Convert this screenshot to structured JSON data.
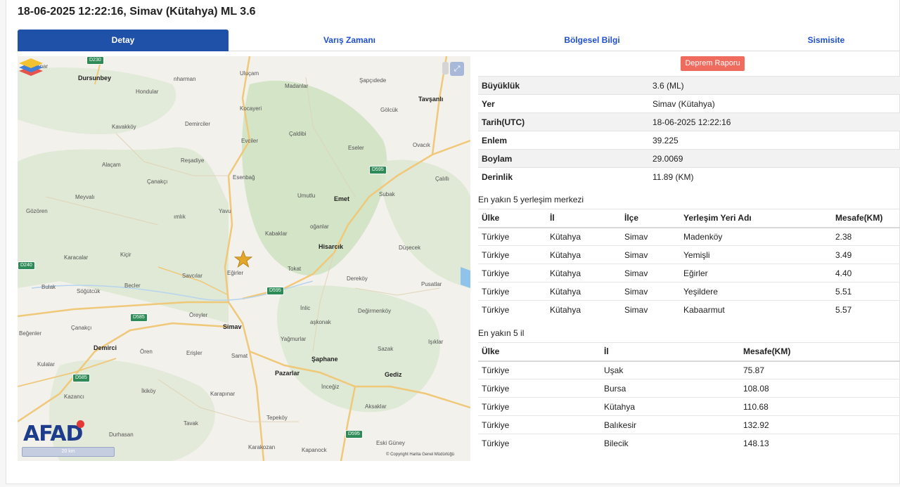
{
  "title": "18-06-2025 12:22:16, Simav (Kütahya) ML 3.6",
  "tabs": [
    {
      "label": "Detay"
    },
    {
      "label": "Varış Zamanı"
    },
    {
      "label": "Bölgesel Bilgi"
    },
    {
      "label": "Sismisite"
    }
  ],
  "report_button": "Deprem Raporu",
  "details": [
    {
      "key": "Büyüklük",
      "value": "3.6 (ML)"
    },
    {
      "key": "Yer",
      "value": "Simav (Kütahya)"
    },
    {
      "key": "Tarih(UTC)",
      "value": "18-06-2025 12:22:16"
    },
    {
      "key": "Enlem",
      "value": "39.225"
    },
    {
      "key": "Boylam",
      "value": "29.0069"
    },
    {
      "key": "Derinlik",
      "value": "11.89 (KM)"
    }
  ],
  "settlements": {
    "heading": "En yakın 5 yerleşim merkezi",
    "columns": [
      "Ülke",
      "İl",
      "İlçe",
      "Yerleşim Yeri Adı",
      "Mesafe(KM)"
    ],
    "rows": [
      [
        "Türkiye",
        "Kütahya",
        "Simav",
        "Madenköy",
        "2.38"
      ],
      [
        "Türkiye",
        "Kütahya",
        "Simav",
        "Yemişli",
        "3.49"
      ],
      [
        "Türkiye",
        "Kütahya",
        "Simav",
        "Eğirler",
        "4.40"
      ],
      [
        "Türkiye",
        "Kütahya",
        "Simav",
        "Yeşildere",
        "5.51"
      ],
      [
        "Türkiye",
        "Kütahya",
        "Simav",
        "Kabaarmut",
        "5.57"
      ]
    ]
  },
  "provinces": {
    "heading": "En yakın 5 il",
    "columns": [
      "Ülke",
      "İl",
      "Mesafe(KM)"
    ],
    "rows": [
      [
        "Türkiye",
        "Uşak",
        "75.87"
      ],
      [
        "Türkiye",
        "Bursa",
        "108.08"
      ],
      [
        "Türkiye",
        "Kütahya",
        "110.68"
      ],
      [
        "Türkiye",
        "Balıkesir",
        "132.92"
      ],
      [
        "Türkiye",
        "Bilecik",
        "148.13"
      ]
    ]
  },
  "map": {
    "logo_text": "AFAD",
    "scale_text": "20 km",
    "copyright": "© Copyright Harita Genel Müdürlüğü",
    "expand_icon": "expand-icon",
    "layers_icon": "layers-icon",
    "epicenter_icon": "star-icon",
    "labels": [
      {
        "text": "Dursunbey",
        "bold": true
      },
      {
        "text": "Karapınar",
        "bold": false
      },
      {
        "text": "Hondular",
        "bold": false
      },
      {
        "text": "nharman",
        "bold": false
      },
      {
        "text": "Uluçam",
        "bold": false
      },
      {
        "text": "Madanlar",
        "bold": false
      },
      {
        "text": "Şapçıdede",
        "bold": false
      },
      {
        "text": "Tavşanlı",
        "bold": true
      },
      {
        "text": "Gölcük",
        "bold": false
      },
      {
        "text": "Kocayeri",
        "bold": false
      },
      {
        "text": "Kavakköy",
        "bold": false
      },
      {
        "text": "Demirciler",
        "bold": false
      },
      {
        "text": "Çaldibi",
        "bold": false
      },
      {
        "text": "Evciler",
        "bold": false
      },
      {
        "text": "Eseler",
        "bold": false
      },
      {
        "text": "Ovacık",
        "bold": false
      },
      {
        "text": "Alaçam",
        "bold": false
      },
      {
        "text": "Reşadiye",
        "bold": false
      },
      {
        "text": "Esenbağ",
        "bold": false
      },
      {
        "text": "Çanakçı",
        "bold": false
      },
      {
        "text": "Umutlu",
        "bold": false
      },
      {
        "text": "Emet",
        "bold": true
      },
      {
        "text": "Subak",
        "bold": false
      },
      {
        "text": "Çalıllı",
        "bold": false
      },
      {
        "text": "Meyvalı",
        "bold": false
      },
      {
        "text": "Yavu",
        "bold": false
      },
      {
        "text": "Gözören",
        "bold": false
      },
      {
        "text": "ımlık",
        "bold": false
      },
      {
        "text": "oğanlar",
        "bold": false
      },
      {
        "text": "Kabaklar",
        "bold": false
      },
      {
        "text": "Hisarcık",
        "bold": true
      },
      {
        "text": "Düşecek",
        "bold": false
      },
      {
        "text": "Karacalar",
        "bold": false
      },
      {
        "text": "Kiçir",
        "bold": false
      },
      {
        "text": "Eğirler",
        "bold": false
      },
      {
        "text": "Tokat",
        "bold": false
      },
      {
        "text": "Bulak",
        "bold": false
      },
      {
        "text": "Söğütcük",
        "bold": false
      },
      {
        "text": "Becler",
        "bold": false
      },
      {
        "text": "Savcılar",
        "bold": false
      },
      {
        "text": "Dereköy",
        "bold": false
      },
      {
        "text": "Pusatlar",
        "bold": false
      },
      {
        "text": "İnlic",
        "bold": false
      },
      {
        "text": "Öreyler",
        "bold": false
      },
      {
        "text": "Değirmenköy",
        "bold": false
      },
      {
        "text": "Simav",
        "bold": true
      },
      {
        "text": "aşkonak",
        "bold": false
      },
      {
        "text": "Çanakçı",
        "bold": false
      },
      {
        "text": "Beğenler",
        "bold": false
      },
      {
        "text": "Demirci",
        "bold": true
      },
      {
        "text": "Ören",
        "bold": false
      },
      {
        "text": "Erişler",
        "bold": false
      },
      {
        "text": "Yağmurlar",
        "bold": false
      },
      {
        "text": "Işıklar",
        "bold": false
      },
      {
        "text": "Samat",
        "bold": false
      },
      {
        "text": "Şaphane",
        "bold": true
      },
      {
        "text": "Sazak",
        "bold": false
      },
      {
        "text": "Kulalar",
        "bold": false
      },
      {
        "text": "Pazarlar",
        "bold": true
      },
      {
        "text": "Gediz",
        "bold": true
      },
      {
        "text": "İkiköy",
        "bold": false
      },
      {
        "text": "İnceğiz",
        "bold": false
      },
      {
        "text": "Kazancı",
        "bold": false
      },
      {
        "text": "Karapınar",
        "bold": false
      },
      {
        "text": "Aksaklar",
        "bold": false
      },
      {
        "text": "Tepeköy",
        "bold": false
      },
      {
        "text": "Durhasan",
        "bold": false
      },
      {
        "text": "Tavak",
        "bold": false
      },
      {
        "text": "Karakozan",
        "bold": false
      },
      {
        "text": "Kapanock",
        "bold": false
      },
      {
        "text": "Eski Güney",
        "bold": false
      }
    ],
    "roads": [
      "D230",
      "D595",
      "D595",
      "D240",
      "D585",
      "D585",
      "D595"
    ]
  }
}
